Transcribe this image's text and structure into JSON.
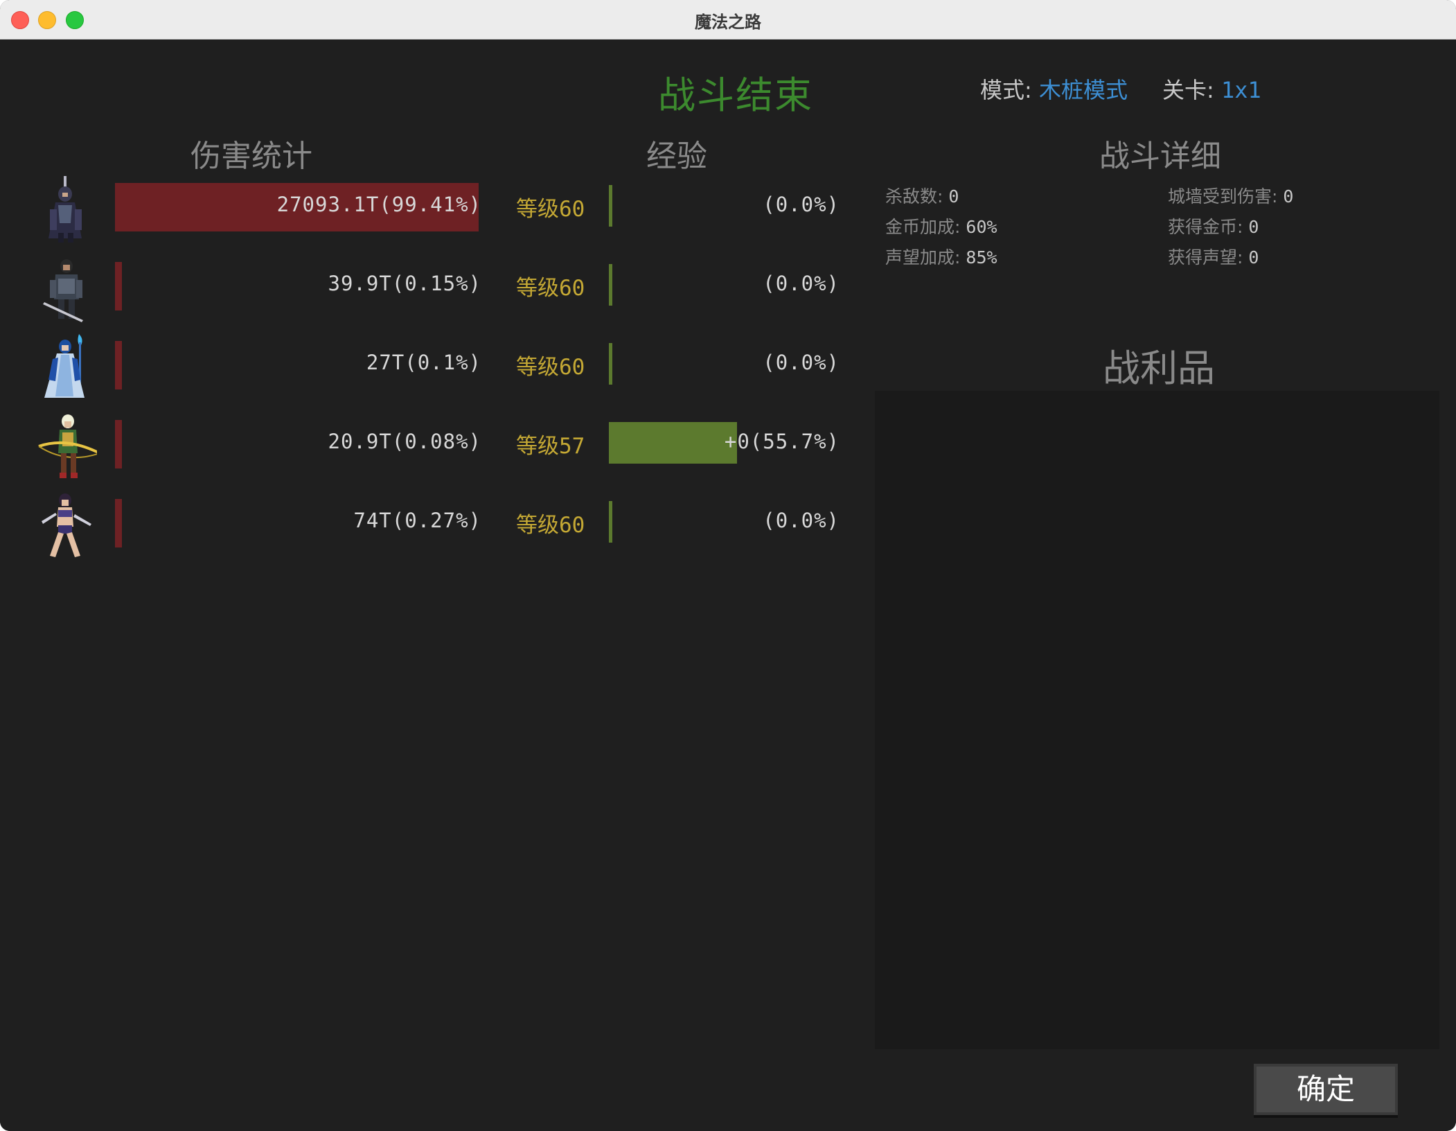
{
  "window": {
    "title": "魔法之路"
  },
  "header": {
    "title": "战斗结束",
    "mode_label": "模式:",
    "mode_value": "木桩模式",
    "stage_label": "关卡:",
    "stage_value": "1x1"
  },
  "sections": {
    "damage": "伤害统计",
    "exp": "经验",
    "details": "战斗详细",
    "loot": "战利品"
  },
  "heroes": [
    {
      "avatar": "dark-knight-sprite",
      "damage": "27093.1T(99.41%)",
      "damage_pct": 99.41,
      "level": "等级60",
      "exp": "(0.0%)",
      "exp_pct": 0.0
    },
    {
      "avatar": "swordsman-sprite",
      "damage": "39.9T(0.15%)",
      "damage_pct": 0.15,
      "level": "等级60",
      "exp": "(0.0%)",
      "exp_pct": 0.0
    },
    {
      "avatar": "ice-mage-sprite",
      "damage": "27T(0.1%)",
      "damage_pct": 0.1,
      "level": "等级60",
      "exp": "(0.0%)",
      "exp_pct": 0.0
    },
    {
      "avatar": "elf-archer-sprite",
      "damage": "20.9T(0.08%)",
      "damage_pct": 0.08,
      "level": "等级57",
      "exp": "+0(55.7%)",
      "exp_pct": 55.7
    },
    {
      "avatar": "dual-blade-warrior-sprite",
      "damage": "74T(0.27%)",
      "damage_pct": 0.27,
      "level": "等级60",
      "exp": "(0.0%)",
      "exp_pct": 0.0
    }
  ],
  "details": {
    "kills_label": "杀敌数:",
    "kills": "0",
    "gold_bonus_label": "金币加成:",
    "gold_bonus": "60%",
    "fame_bonus_label": "声望加成:",
    "fame_bonus": "85%",
    "wall_damage_label": "城墙受到伤害:",
    "wall_damage": "0",
    "gold_gained_label": "获得金币:",
    "gold_gained": "0",
    "fame_gained_label": "获得声望:",
    "fame_gained": "0"
  },
  "confirm_label": "确定",
  "colors": {
    "background": "#1f1f1f",
    "title_green": "#3c8a2e",
    "link_blue": "#3d8fd4",
    "damage_bar": "#6e2124",
    "exp_bar": "#5c7a2e",
    "level_gold": "#c4a834"
  }
}
